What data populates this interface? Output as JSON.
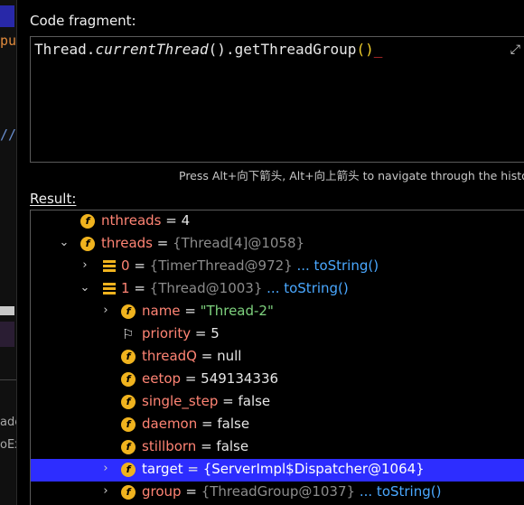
{
  "left_strip": {
    "frag_pu": "pu",
    "frag_slashes": "//",
    "frag_ade": "ade",
    "frag_ex": "oEx"
  },
  "code_fragment": {
    "label": "Code fragment:",
    "code_prefix": "Thread.",
    "code_method": "currentThread",
    "code_open": "()",
    "code_middle": ".getThreadGroup",
    "code_call": "()",
    "caret": "_",
    "hint": "Press Alt+向下箭头, Alt+向上箭头 to navigate through the histo"
  },
  "result": {
    "label": "Result:",
    "rows": [
      {
        "key": "nthreads",
        "val": "4"
      },
      {
        "key": "threads",
        "ref": "{Thread[4]@1058}"
      },
      {
        "key": "0",
        "ref": "{TimerThread@972}",
        "link": "... toString()"
      },
      {
        "key": "1",
        "ref": "{Thread@1003}",
        "link": "... toString()"
      },
      {
        "key": "name",
        "str": "\"Thread-2\""
      },
      {
        "key": "priority",
        "val": "5"
      },
      {
        "key": "threadQ",
        "val": "null"
      },
      {
        "key": "eetop",
        "val": "549134336"
      },
      {
        "key": "single_step",
        "val": "false"
      },
      {
        "key": "daemon",
        "val": "false"
      },
      {
        "key": "stillborn",
        "val": "false"
      },
      {
        "key": "target",
        "ref": "{ServerImpl$Dispatcher@1064}"
      },
      {
        "key": "group",
        "ref": "{ThreadGroup@1037}",
        "link": "... toString()"
      }
    ]
  },
  "colors": {
    "selection": "#2d2dff",
    "field_icon": "#f0b31e",
    "key": "#ff8474",
    "string": "#7ed27e",
    "link": "#4aa8ff"
  }
}
